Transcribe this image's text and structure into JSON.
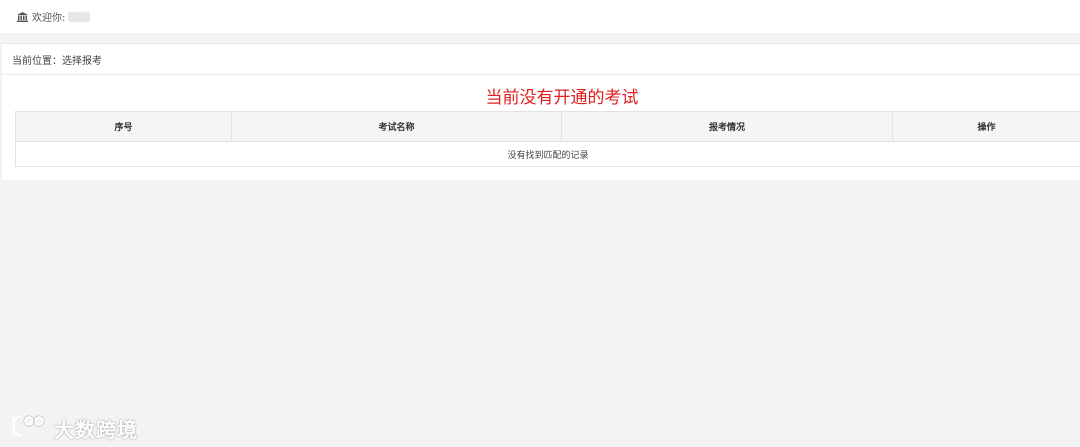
{
  "header": {
    "welcome_label": "欢迎你:"
  },
  "breadcrumb": {
    "text": "当前位置：选择报考"
  },
  "notice": {
    "text": "当前没有开通的考试"
  },
  "table": {
    "columns": [
      "序号",
      "考试名称",
      "报考情况",
      "操作"
    ],
    "empty_message": "没有找到匹配的记录"
  },
  "watermark": {
    "text": "大数跨境"
  },
  "colors": {
    "notice": "#e02020",
    "background": "#f3f3f3"
  }
}
